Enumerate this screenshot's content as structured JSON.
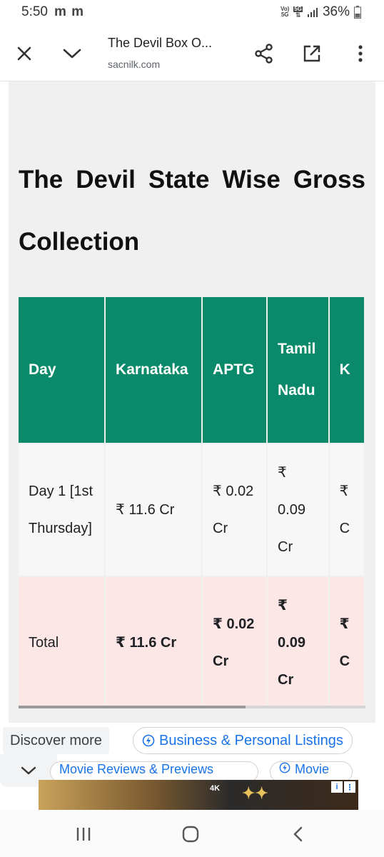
{
  "status_bar": {
    "time": "5:50",
    "notif_icons": "m m",
    "network_top": "Vo)",
    "network_bottom": "5G",
    "lte_top": "5G",
    "battery": "36%"
  },
  "browser": {
    "title": "The Devil Box O...",
    "domain": "sacnilk.com"
  },
  "article": {
    "heading": "The Devil State Wise Gross Collection",
    "table": {
      "headers": [
        "Day",
        "Karnataka",
        "APTG",
        "Tamil Nadu",
        "K"
      ],
      "day_row": [
        "Day 1 [1st Thursday]",
        "₹ 11.6 Cr",
        "₹ 0.02 Cr",
        "₹ 0.09 Cr",
        "₹ C"
      ],
      "total_row": [
        "Total",
        "₹ 11.6 Cr",
        "₹ 0.02 Cr",
        "₹ 0.09 Cr",
        "₹ C"
      ]
    }
  },
  "discover": {
    "label": "Discover more",
    "chips": [
      "Business & Personal Listings"
    ],
    "chips_row2": [
      "Movie Reviews & Previews",
      "Movie"
    ]
  },
  "ad": {
    "tag": "4K"
  },
  "colors": {
    "table_header": "#0a8a6a",
    "total_row": "#fde6e6",
    "link": "#1a73e8"
  }
}
